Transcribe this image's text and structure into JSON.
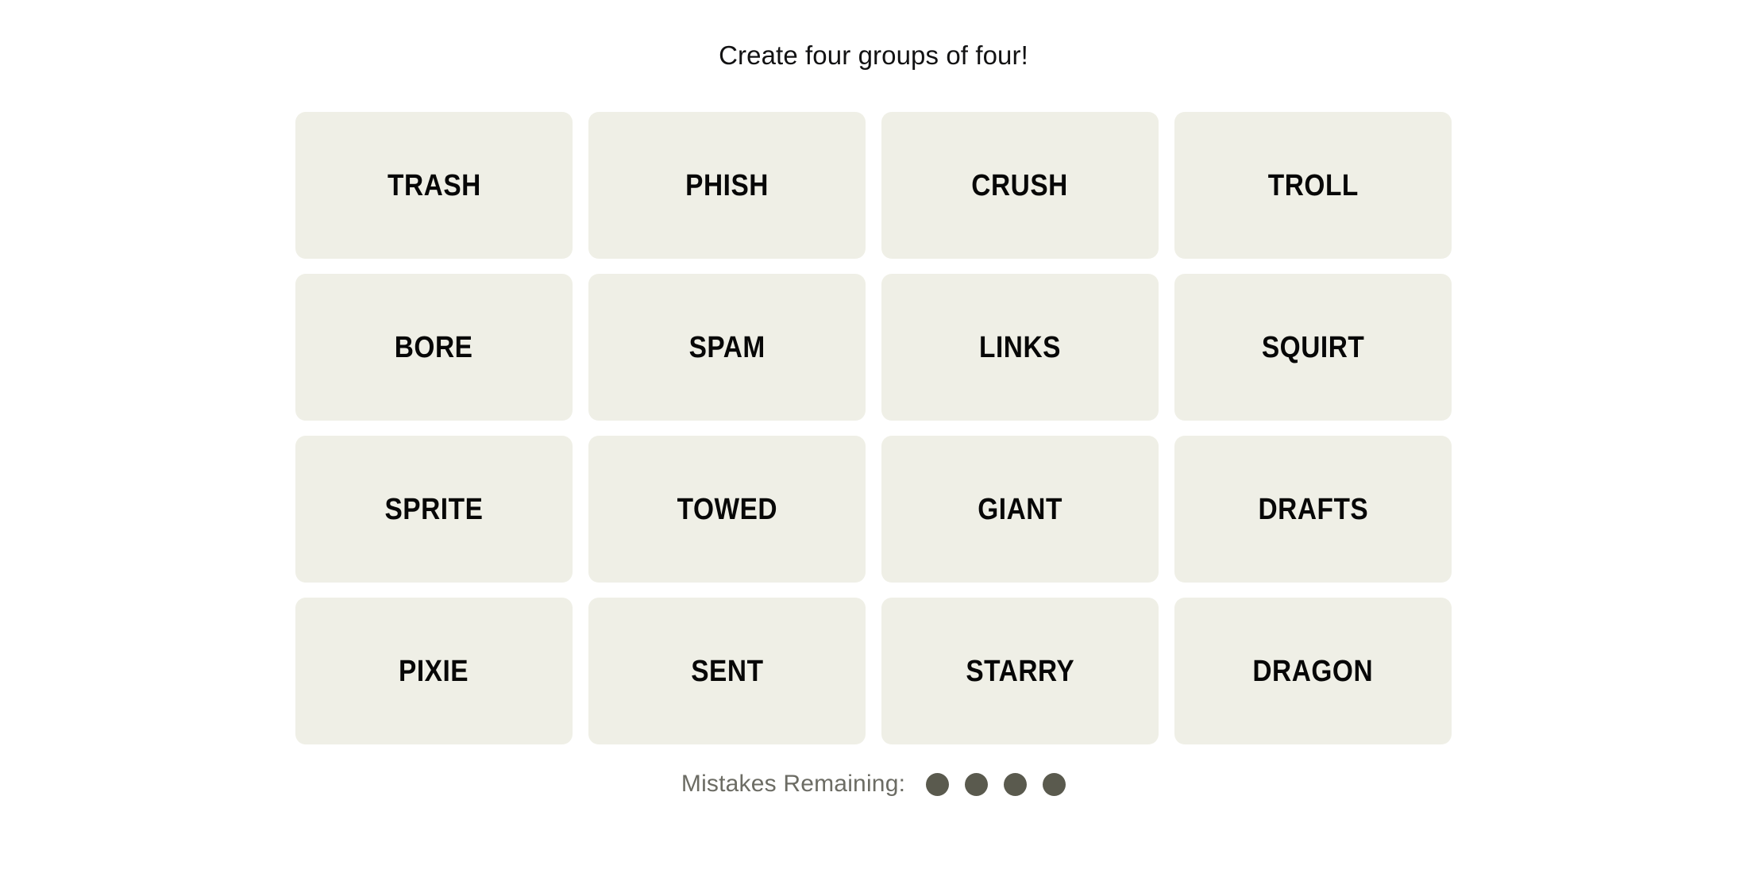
{
  "game": {
    "title": "Create four groups of four!",
    "tiles": [
      {
        "word": "TRASH"
      },
      {
        "word": "PHISH"
      },
      {
        "word": "CRUSH"
      },
      {
        "word": "TROLL"
      },
      {
        "word": "BORE"
      },
      {
        "word": "SPAM"
      },
      {
        "word": "LINKS"
      },
      {
        "word": "SQUIRT"
      },
      {
        "word": "SPRITE"
      },
      {
        "word": "TOWED"
      },
      {
        "word": "GIANT"
      },
      {
        "word": "DRAFTS"
      },
      {
        "word": "PIXIE"
      },
      {
        "word": "SENT"
      },
      {
        "word": "STARRY"
      },
      {
        "word": "DRAGON"
      }
    ],
    "footer": {
      "mistakes_label": "Mistakes Remaining:",
      "mistakes_remaining": 4,
      "dots": [
        "dot",
        "dot",
        "dot",
        "dot"
      ]
    }
  },
  "colors": {
    "page_background": "#FFFFFF",
    "tile_background": "#EFEFE6",
    "tile_text": "#070707",
    "title_text": "#121213",
    "mistakes_label_text": "#6C6C64",
    "dot_fill": "#5A5A4E"
  }
}
